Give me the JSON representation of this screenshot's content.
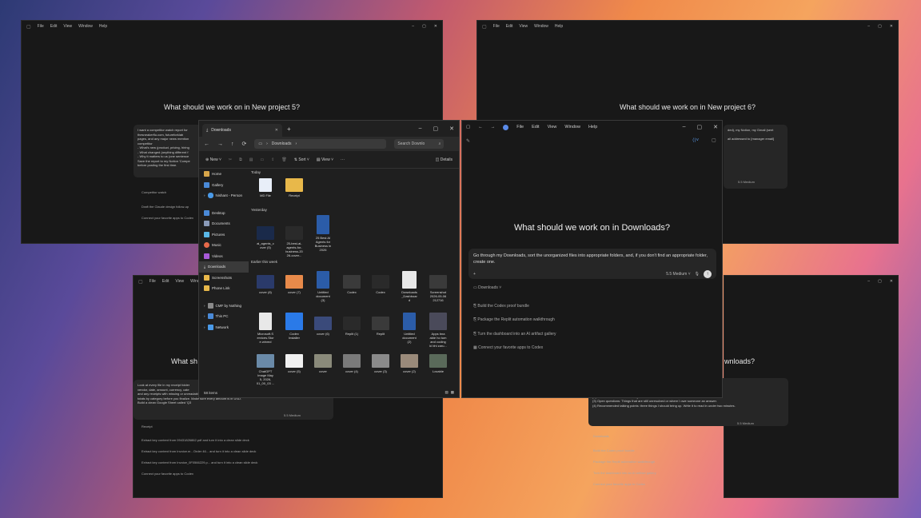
{
  "menu": {
    "file": "File",
    "edit": "Edit",
    "view": "View",
    "window": "Window",
    "help": "Help"
  },
  "bg_tl": {
    "title": "What should we work on in New project 5?",
    "card": "I want a competitor watch report for\nthesneakerflu.com, futureforklab\npages, and any major news mention\ncompetitor\n- What's new (product, pricing, hiring\n- What changed (anything different f\n- Why it matters to us (one sentence\nSave the report to my Notion 'Compe\nbefore posting the first time.",
    "folder": "Competitor watch",
    "items": [
      "Draft the Claude design follow-up",
      "Connect your favorite apps to Codex"
    ]
  },
  "bg_tr": {
    "title": "What should we work on in New project 6?",
    "card": "ded), my Notion, my Gmail (sent\n\nail addressed to [manager email]",
    "model": "5.5 Medium"
  },
  "bg_bl": {
    "title": "What sh",
    "card": "Look at every file in my receipt folder\nvendor, date, amount, currency, cate\nand any receipts with missing or unreadable amounts in a separate tab so I can fix them. Show me a summary of\ntotals by category before you finalize. Make sure every amount is in USD.\nBuild a clean Google Sheet called 'Q3",
    "model": "5.5 Medium",
    "folder": "Receipt",
    "items": [
      "Extract key content from 09431826862.pdf and turn it into a clean slide deck",
      "Extract key content from Invoice.m - Order 46... and turn it into a clean slide deck",
      "Extract key content from Invoice_0F0566229.p... and turn it into a clean slide deck",
      "Connect your favorite apps to Codex"
    ]
  },
  "bg_br": {
    "title": "wnloads?",
    "card": "the program. Pull every doc and\nownload folder. Build me a one-\n(1) Context: What this meeting is for in two sentences\n(2) What's been decided already: Bullet list of resolved items\n(3) Open questions: Things that are still unresolved or where I owe someone an answer.\n(4) Recommended talking points: three things I should bring up. Write it to read in under two minutes.",
    "model": "5.5 Medium",
    "folder": "Downloads",
    "items": [
      "Build the Codex proof bundle",
      "Package the Replit automation walkthrough",
      "Turn the dashboard into an AI artifact gallery",
      "Connect your favorite apps to Codex"
    ]
  },
  "explorer": {
    "tab": "Downloads",
    "path": "Downloads",
    "search": "Search Downlo",
    "cmd": {
      "new": "New",
      "sort": "Sort",
      "view": "View",
      "details": "Details"
    },
    "nav": [
      "Home",
      "Gallery",
      "Nishant - Person",
      "Desktop",
      "Documents",
      "Pictures",
      "Music",
      "Videos",
      "Downloads",
      "Screenshots",
      "Phone Link",
      "CMF by Nothing",
      "This PC",
      "Network"
    ],
    "groups": [
      "Today",
      "Yesterday",
      "Earlier this week"
    ],
    "today": [
      "MD File",
      "Receipt"
    ],
    "yesterday": [
      "ai_agents_c\nover (5)",
      "25-best-ai-\nagents-for-\nbusiness-20\n26-cover...",
      "25 Best AI\nAgents for\nBusiness in\n2026"
    ],
    "earlier1": [
      "cover (8)",
      "cover (7)",
      "Untitled\ndocument\n(3)",
      "Codex",
      "Codex",
      "Downloads\n_Dashboar\nd",
      "Screenshot\n2026-05-06\n212716"
    ],
    "earlier2": [
      "Microsoft.S\nervices.Stor\ne.winmd",
      "Codex\nInstaller",
      "cover (6)",
      "Replit (1)",
      "Replit",
      "Untitled\ndocument\n(2)",
      "Apps bna\nakte ho tum\nand coding\nki bhi zaru..."
    ],
    "earlier3": [
      "ChatGPT\nImage May\n5, 2026,\n01_00_03 ...",
      "cover (5)",
      "cover",
      "cover (4)",
      "cover (3)",
      "cover (2)",
      "Lovable"
    ],
    "status": "58 items"
  },
  "codex": {
    "question": "What should we work on in Downloads?",
    "prompt": "Go through my Downloads, sort the unorganized files into appropriate folders, and, if you don't find an appropriate folder, create one.",
    "model": "5.5",
    "effort": "Medium",
    "folder": "Downloads",
    "suggestions": [
      "Build the Codex proof bundle",
      "Package the Replit automation walkthrough",
      "Turn the dashboard into an AI artifact gallery",
      "Connect your favorite apps to Codex"
    ]
  }
}
